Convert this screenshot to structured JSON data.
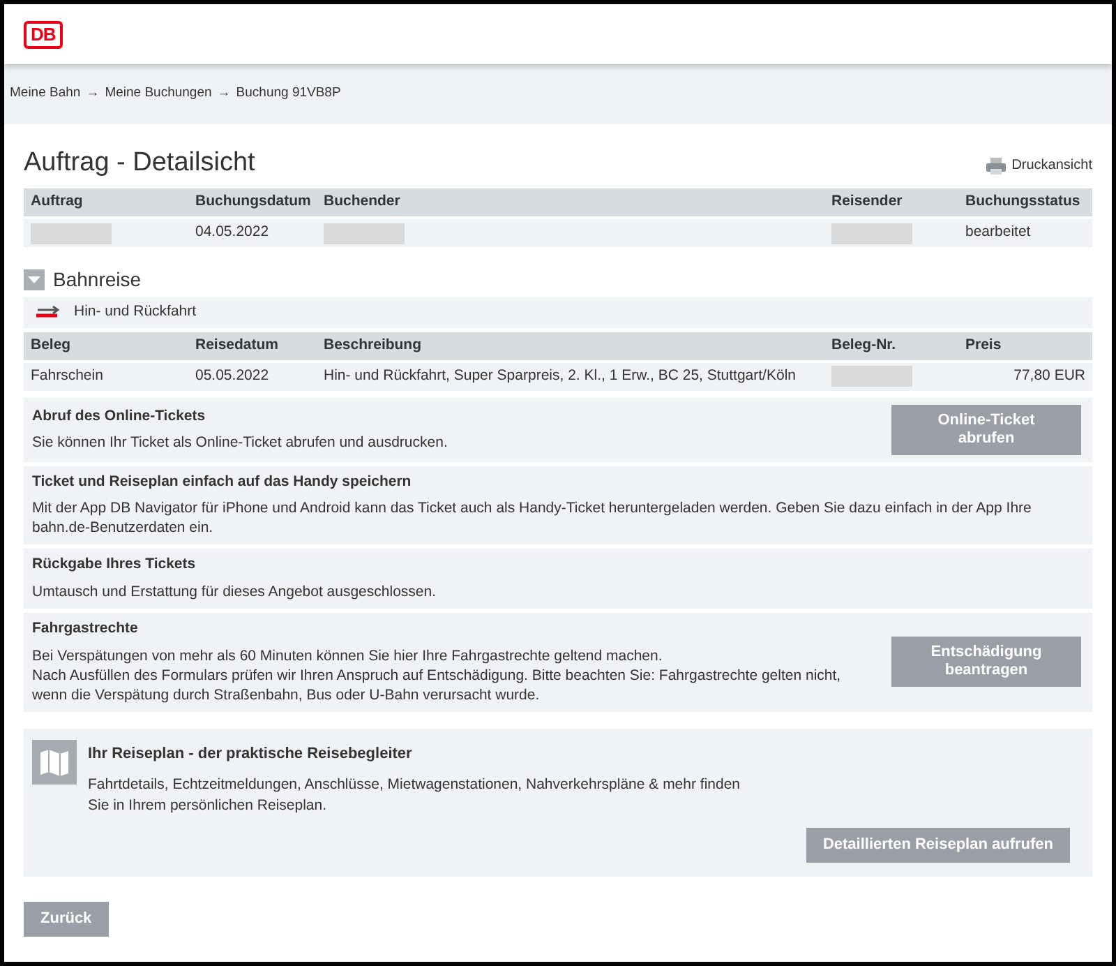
{
  "header": {
    "logo": "DB"
  },
  "breadcrumb": [
    "Meine Bahn",
    "Meine Buchungen",
    "Buchung 91VB8P"
  ],
  "breadcrumb_separator": "→",
  "page_title": "Auftrag - Detailsicht",
  "print_link": "Druckansicht",
  "order_table": {
    "columns": [
      "Auftrag",
      "Buchungsdatum",
      "Buchender",
      "Reisender",
      "Buchungsstatus"
    ],
    "rows": [
      [
        {
          "kind": "redacted"
        },
        {
          "kind": "text",
          "text": "04.05.2022"
        },
        {
          "kind": "redacted"
        },
        {
          "kind": "redacted"
        },
        {
          "kind": "text",
          "text": "bearbeitet"
        }
      ]
    ]
  },
  "section": {
    "title": "Bahnreise",
    "expanded": true,
    "trip_type": "Hin- und Rückfahrt"
  },
  "ticket_table": {
    "columns": [
      "Beleg",
      "Reisedatum",
      "Beschreibung",
      "Beleg-Nr.",
      "Preis"
    ],
    "rows": [
      [
        {
          "kind": "text",
          "text": "Fahrschein"
        },
        {
          "kind": "text",
          "text": "05.05.2022"
        },
        {
          "kind": "text",
          "text": "Hin- und Rückfahrt, Super Sparpreis, 2. Kl., 1 Erw., BC 25, Stuttgart/Köln"
        },
        {
          "kind": "redacted"
        },
        {
          "kind": "text",
          "text": "77,80 EUR"
        }
      ]
    ]
  },
  "info_blocks": [
    {
      "title": "Abruf des Online-Tickets",
      "text": [
        "Sie können Ihr Ticket als Online-Ticket abrufen und ausdrucken."
      ],
      "button": "Online-Ticket abrufen"
    },
    {
      "title": "Ticket und Reiseplan einfach auf das Handy speichern",
      "text": [
        "Mit der App DB Navigator für iPhone und Android kann das Ticket auch als Handy-Ticket heruntergeladen werden. Geben Sie dazu einfach in der App Ihre bahn.de-Benutzerdaten ein."
      ]
    },
    {
      "title": "Rückgabe Ihres Tickets",
      "text": [
        "Umtausch und Erstattung für dieses Angebot ausgeschlossen."
      ]
    },
    {
      "title": "Fahrgastrechte",
      "text": [
        "Bei Verspätungen von mehr als 60 Minuten können Sie hier Ihre Fahrgastrechte geltend machen.",
        "Nach Ausfüllen des Formulars prüfen wir Ihren Anspruch auf Entschädigung. Bitte beachten Sie: Fahrgastrechte gelten nicht, wenn die Verspätung durch Straßenbahn, Bus oder U-Bahn verursacht wurde."
      ],
      "button": "Entschädigung beantragen"
    }
  ],
  "travel_plan": {
    "title": "Ihr Reiseplan - der praktische Reisebegleiter",
    "text": "Fahrtdetails, Echtzeitmeldungen, Anschlüsse, Mietwagenstationen, Nahverkehrspläne & mehr finden Sie in Ihrem persönlichen Reiseplan.",
    "button": "Detaillierten Reiseplan aufrufen"
  },
  "back_button": "Zurück"
}
